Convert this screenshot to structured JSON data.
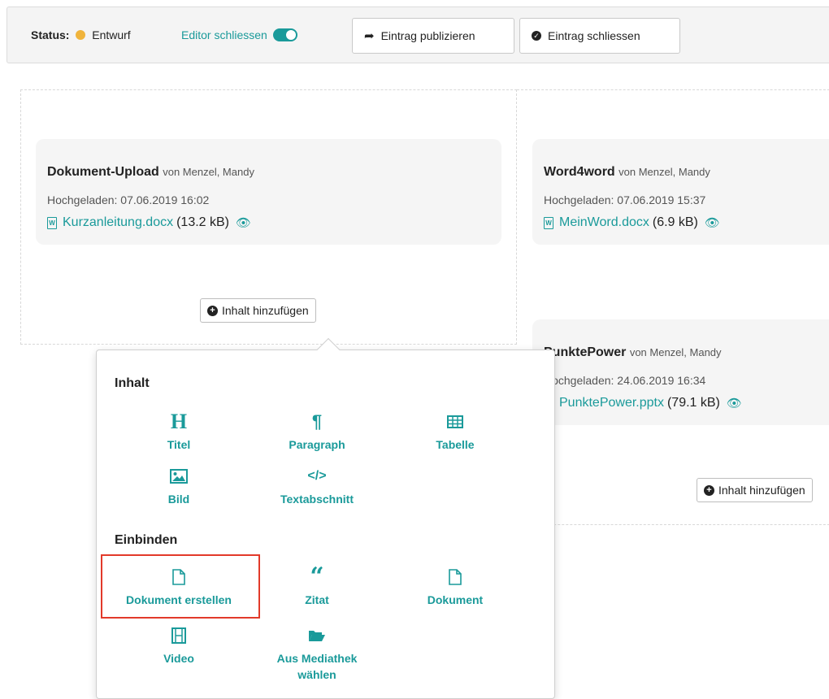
{
  "toolbar": {
    "status_label": "Status:",
    "status_value": "Entwurf",
    "editor_toggle_label": "Editor schliessen",
    "publish_label": "Eintrag publizieren",
    "close_entry_label": "Eintrag schliessen"
  },
  "cards": [
    {
      "title": "Dokument-Upload",
      "by": "von Menzel, Mandy",
      "uploaded": "Hochgeladen: 07.06.2019 16:02",
      "file": "Kurzanleitung.docx",
      "size": "(13.2 kB)"
    },
    {
      "title": "Word4word",
      "by": "von Menzel, Mandy",
      "uploaded": "Hochgeladen: 07.06.2019 15:37",
      "file": "MeinWord.docx",
      "size": "(6.9 kB)"
    },
    {
      "title": "PunktePower",
      "by": "von Menzel, Mandy",
      "uploaded": "Hochgeladen: 24.06.2019 16:34",
      "file": "PunktePower.pptx",
      "size": "(79.1 kB)"
    }
  ],
  "add_content_label": "Inhalt hinzufügen",
  "popover": {
    "section_content": "Inhalt",
    "section_embed": "Einbinden",
    "items_content": [
      "Titel",
      "Paragraph",
      "Tabelle",
      "Bild",
      "Textabschnitt"
    ],
    "items_embed": [
      "Dokument erstellen",
      "Zitat",
      "Dokument",
      "Video",
      "Aus Mediathek wählen"
    ]
  },
  "colors": {
    "accent": "#1a9a9a",
    "status_dot": "#f0b43c",
    "highlight": "#e23a2a"
  }
}
